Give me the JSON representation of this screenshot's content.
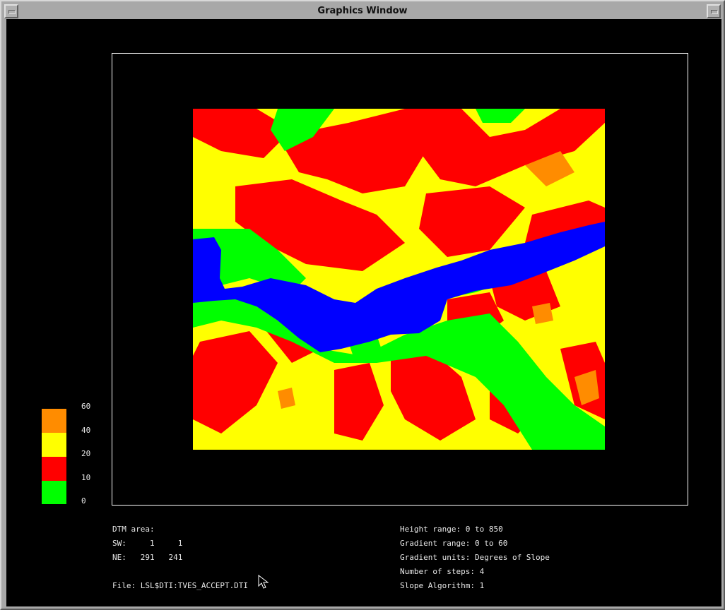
{
  "window": {
    "title": "Graphics Window"
  },
  "legend": {
    "colors": [
      "#00ff00",
      "#ff0000",
      "#ffff00",
      "#ff8c00"
    ],
    "labels": [
      "60",
      "40",
      "20",
      "10",
      "0"
    ]
  },
  "map_colors": {
    "water": "#0000ff",
    "flat": "#00ff00",
    "gentle": "#ff0000",
    "moderate": "#ffff00",
    "steep": "#ff8c00"
  },
  "dtm": {
    "area_label": "DTM area:",
    "sw_line": "SW:     1     1",
    "ne_line": "NE:   291   241",
    "file_line": "File: LSL$DTI:TVES_ACCEPT.DTI"
  },
  "stats": {
    "height_range": "Height range: 0 to 850",
    "gradient_range": "Gradient range: 0 to 60",
    "gradient_units": "Gradient units: Degrees of Slope",
    "number_of_steps": "Number of steps: 4",
    "slope_algorithm": "Slope Algorithm: 1"
  }
}
